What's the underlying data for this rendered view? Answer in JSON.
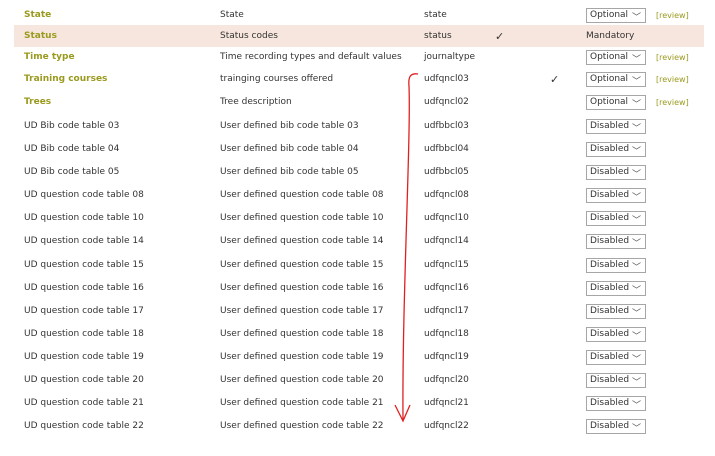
{
  "rows": [
    {
      "name": "State",
      "desc": "State",
      "code": "state",
      "check": "",
      "select": "Optional",
      "review": "[review]"
    },
    {
      "name": "Status",
      "desc": "Status codes",
      "code": "status",
      "check": "✓",
      "static": "Mandatory"
    },
    {
      "name": "Time type",
      "desc": "Time recording types and default values",
      "code": "journaltype",
      "check": "",
      "select": "Optional",
      "review": "[review]"
    },
    {
      "name": "Training courses",
      "desc": "trainging courses offered",
      "code": "udfqncl03",
      "check2": "✓",
      "select": "Optional",
      "review": "[review]"
    },
    {
      "name": "Trees",
      "desc": "Tree description",
      "code": "udfqncl02",
      "select": "Optional",
      "review": "[review]"
    },
    {
      "name": "UD Bib code table 03",
      "desc": "User defined bib code table 03",
      "code": "udfbbcl03",
      "select": "Disabled"
    },
    {
      "name": "UD Bib code table 04",
      "desc": "User defined bib code table 04",
      "code": "udfbbcl04",
      "select": "Disabled"
    },
    {
      "name": "UD Bib code table 05",
      "desc": "User defined bib code table 05",
      "code": "udfbbcl05",
      "select": "Disabled"
    },
    {
      "name": "UD question code table 08",
      "desc": "User defined question code table 08",
      "code": "udfqncl08",
      "select": "Disabled"
    },
    {
      "name": "UD question code table 10",
      "desc": "User defined question code table 10",
      "code": "udfqncl10",
      "select": "Disabled"
    },
    {
      "name": "UD question code table 14",
      "desc": "User defined question code table 14",
      "code": "udfqncl14",
      "select": "Disabled"
    },
    {
      "name": "UD question code table 15",
      "desc": "User defined question code table 15",
      "code": "udfqncl15",
      "select": "Disabled"
    },
    {
      "name": "UD question code table 16",
      "desc": "User defined question code table 16",
      "code": "udfqncl16",
      "select": "Disabled"
    },
    {
      "name": "UD question code table 17",
      "desc": "User defined question code table 17",
      "code": "udfqncl17",
      "select": "Disabled"
    },
    {
      "name": "UD question code table 18",
      "desc": "User defined question code table 18",
      "code": "udfqncl18",
      "select": "Disabled"
    },
    {
      "name": "UD question code table 19",
      "desc": "User defined question code table 19",
      "code": "udfqncl19",
      "select": "Disabled"
    },
    {
      "name": "UD question code table 20",
      "desc": "User defined question code table 20",
      "code": "udfqncl20",
      "select": "Disabled"
    },
    {
      "name": "UD question code table 21",
      "desc": "User defined question code table 21",
      "code": "udfqncl21",
      "select": "Disabled"
    },
    {
      "name": "UD question code table 22",
      "desc": "User defined question code table 22",
      "code": "udfqncl22",
      "select": "Disabled"
    }
  ],
  "icons": {
    "dropdown": "chevron-down-icon",
    "checkmark": "checkmark-icon",
    "annotation": "red-arrow-annotation"
  },
  "colors": {
    "accent": "#9a9a1e",
    "highlight": "#f7e6dd",
    "annotation": "#e02020"
  }
}
